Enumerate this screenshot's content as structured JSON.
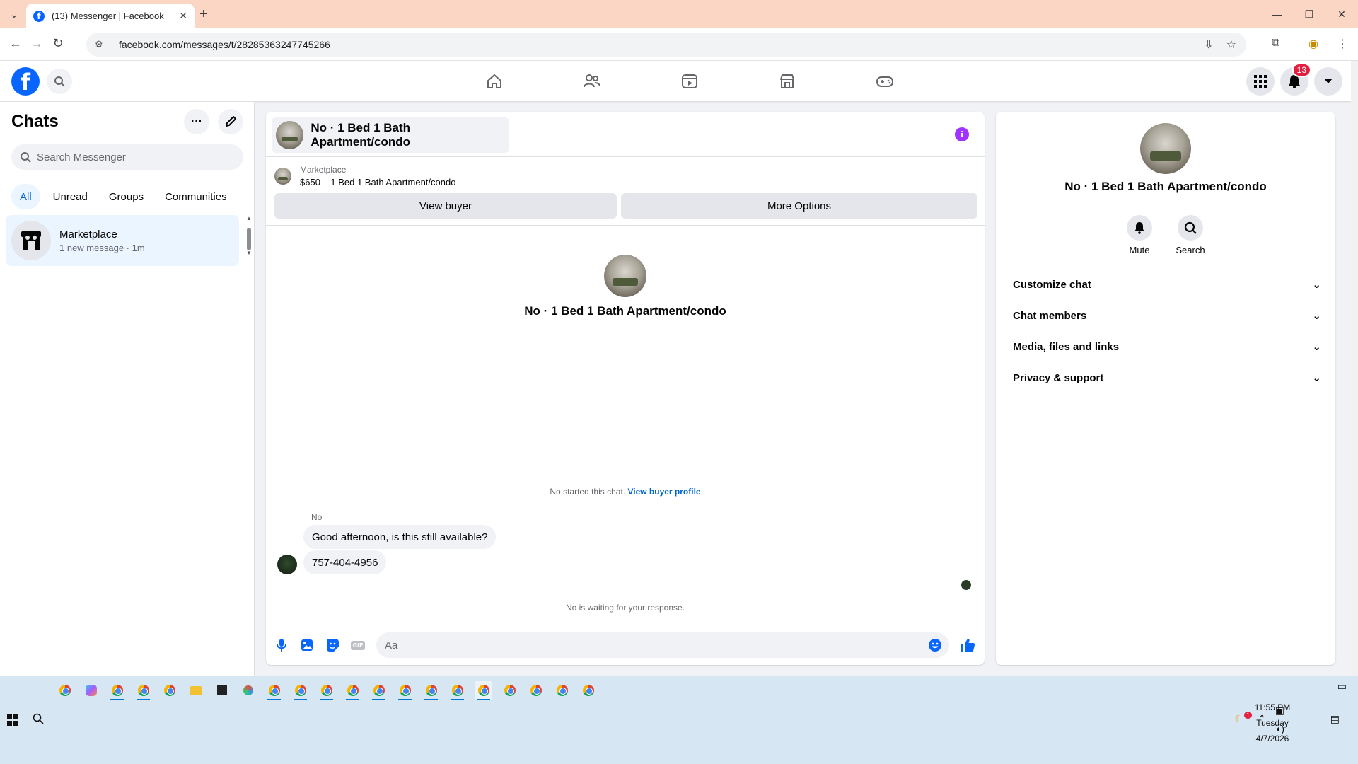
{
  "browser": {
    "tab_title": "(13) Messenger | Facebook",
    "url": "facebook.com/messages/t/28285363247745266"
  },
  "fb_nav": {
    "notification_count": "13",
    "nav_items": [
      "home",
      "friends",
      "video",
      "marketplace",
      "gaming"
    ]
  },
  "chats": {
    "title": "Chats",
    "search_placeholder": "Search Messenger",
    "filters": [
      "All",
      "Unread",
      "Groups",
      "Communities"
    ],
    "active_filter": "All",
    "items": [
      {
        "name": "Marketplace",
        "preview": "1 new message · 1m"
      }
    ]
  },
  "conversation": {
    "title": "No · 1 Bed 1 Bath Apartment/condo",
    "listing": {
      "source": "Marketplace",
      "title": "$650 – 1 Bed 1 Bath Apartment/condo",
      "view_buyer_label": "View buyer",
      "more_options_label": "More Options"
    },
    "profile_name": "No · 1 Bed 1 Bath Apartment/condo",
    "started_note": "No started this chat.",
    "started_link": "View buyer profile",
    "sender": "No",
    "messages": [
      "Good afternoon, is this still available?",
      "757-404-4956"
    ],
    "waiting_note": "No is waiting for your response.",
    "composer_placeholder": "Aa"
  },
  "info_panel": {
    "name": "No · 1 Bed 1 Bath Apartment/condo",
    "actions": [
      {
        "label": "Mute",
        "icon": "bell-icon"
      },
      {
        "label": "Search",
        "icon": "search-icon"
      }
    ],
    "sections": [
      "Customize chat",
      "Chat members",
      "Media, files and links",
      "Privacy & support"
    ]
  },
  "taskbar": {
    "time": "11:55 PM",
    "day": "Tuesday",
    "date": "4/7/2026",
    "badge": "1"
  },
  "colors": {
    "accent": "#0866ff",
    "active_chat_bg": "#ebf5ff",
    "info_icon": "#a033ff",
    "tab_bar": "#fbd6c4",
    "taskbar": "#d6e6f2"
  }
}
